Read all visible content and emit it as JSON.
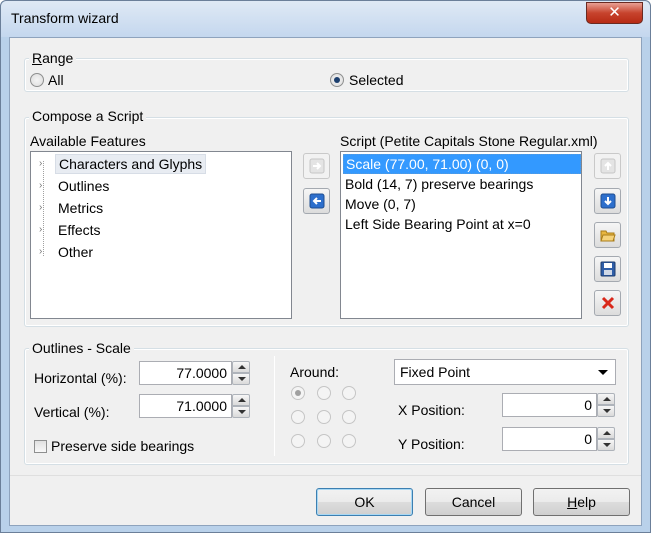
{
  "window": {
    "title": "Transform wizard",
    "close_glyph": "✕"
  },
  "range": {
    "legend_prefix": "R",
    "legend_rest": "ange",
    "all_label": "All",
    "selected_label": "Selected",
    "value": "Selected"
  },
  "compose": {
    "legend": "Compose a Script",
    "features_label": "Available Features",
    "features": [
      "Characters and Glyphs",
      "Outlines",
      "Metrics",
      "Effects",
      "Other"
    ],
    "script_label": "Script (Petite Capitals Stone Regular.xml)",
    "script_items": [
      "Scale (77.00, 71.00) (0, 0)",
      "Bold (14, 7) preserve bearings",
      "Move (0, 7)",
      "Left Side Bearing Point at x=0"
    ],
    "selected_script_index": 0
  },
  "scale": {
    "legend": "Outlines - Scale",
    "horizontal_label": "Horizontal (%):",
    "horizontal_value": "77.0000",
    "vertical_label": "Vertical (%):",
    "vertical_value": "71.0000",
    "preserve_label": "Preserve side bearings",
    "preserve_checked": false,
    "around_label": "Around:",
    "around_value": "Fixed Point",
    "x_label": "X Position:",
    "x_value": "0",
    "y_label": "Y Position:",
    "y_value": "0"
  },
  "buttons": {
    "ok": "OK",
    "cancel": "Cancel",
    "help_prefix": "H",
    "help_rest": "elp"
  },
  "icons": {
    "add": "arrow-right-icon",
    "remove": "arrow-left-icon",
    "move_up": "arrow-up-icon",
    "move_down": "arrow-down-icon",
    "open": "folder-open-icon",
    "save": "floppy-disk-icon",
    "delete": "red-x-icon"
  },
  "colors": {
    "selection": "#3399ff",
    "delete_icon": "#d9281a",
    "accent_icon": "#2d6fcc"
  }
}
